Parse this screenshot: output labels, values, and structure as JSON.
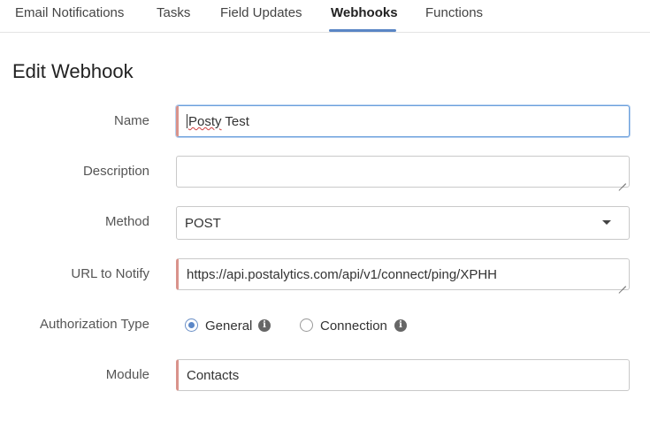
{
  "tabs": [
    {
      "label": "Email Notifications",
      "active": false
    },
    {
      "label": "Tasks",
      "active": false
    },
    {
      "label": "Field Updates",
      "active": false
    },
    {
      "label": "Webhooks",
      "active": true
    },
    {
      "label": "Functions",
      "active": false
    }
  ],
  "page_title": "Edit Webhook",
  "form": {
    "name": {
      "label": "Name",
      "value": "Posty Test",
      "value_word1": "Posty",
      "value_rest": " Test"
    },
    "description": {
      "label": "Description",
      "value": ""
    },
    "method": {
      "label": "Method",
      "value": "POST"
    },
    "url": {
      "label": "URL to Notify",
      "value": "https://api.postalytics.com/api/v1/connect/ping/XPHH"
    },
    "authorization": {
      "label": "Authorization Type",
      "options": [
        {
          "label": "General",
          "selected": true
        },
        {
          "label": "Connection",
          "selected": false
        }
      ]
    },
    "module": {
      "label": "Module",
      "value": "Contacts"
    }
  },
  "icons": {
    "info": "info-icon",
    "dropdown": "chevron-down-icon",
    "resize": "resize-grip-icon"
  },
  "colors": {
    "accent": "#5a86c5",
    "required": "#d9938b",
    "focus": "#6a9fdc"
  }
}
